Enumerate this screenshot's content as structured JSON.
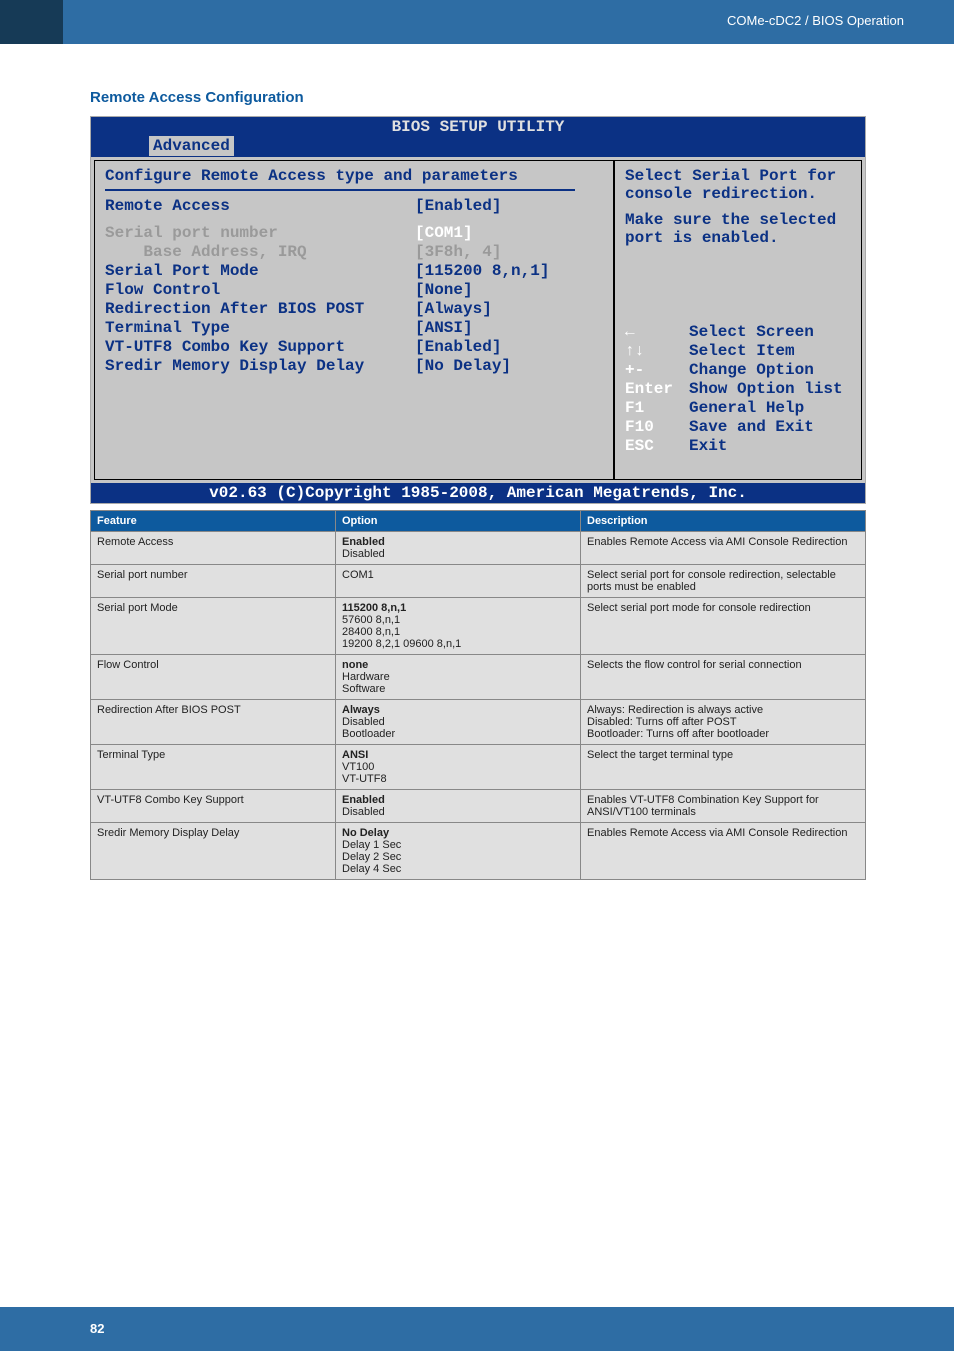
{
  "header": {
    "label": "COMe-cDC2 / BIOS Operation"
  },
  "title": "Remote Access Configuration",
  "bios": {
    "title": "BIOS SETUP UTILITY",
    "tab": "Advanced",
    "heading": "Configure Remote Access type and parameters",
    "rows": [
      {
        "label": "Remote Access",
        "value": "[Enabled]",
        "labelClass": "blue-txt",
        "valueClass": "blue-txt"
      },
      {
        "spacer": true
      },
      {
        "label": "Serial port number",
        "value": "[COM1]",
        "labelClass": "lgray-txt",
        "valueClass": "white-txt"
      },
      {
        "label": "    Base Address, IRQ",
        "value": "[3F8h, 4]",
        "labelClass": "lgray-txt",
        "valueClass": "lgray-txt"
      },
      {
        "label": "Serial Port Mode",
        "value": "[115200 8,n,1]",
        "labelClass": "blue-txt",
        "valueClass": "blue-txt"
      },
      {
        "label": "Flow Control",
        "value": "[None]",
        "labelClass": "blue-txt",
        "valueClass": "blue-txt"
      },
      {
        "label": "Redirection After BIOS POST",
        "value": "[Always]",
        "labelClass": "blue-txt",
        "valueClass": "blue-txt"
      },
      {
        "label": "Terminal Type",
        "value": "[ANSI]",
        "labelClass": "blue-txt",
        "valueClass": "blue-txt"
      },
      {
        "label": "VT-UTF8 Combo Key Support",
        "value": "[Enabled]",
        "labelClass": "blue-txt",
        "valueClass": "blue-txt"
      },
      {
        "label": "Sredir Memory Display Delay",
        "value": "[No Delay]",
        "labelClass": "blue-txt",
        "valueClass": "blue-txt"
      }
    ],
    "right": {
      "hint1": "Select Serial Port for",
      "hint2": "console redirection.",
      "hint3": "Make sure the selected",
      "hint4": "port is enabled."
    },
    "help": [
      {
        "key": "←",
        "label": "Select Screen"
      },
      {
        "key": "↑↓",
        "label": "Select Item"
      },
      {
        "key": "+-",
        "label": "Change Option"
      },
      {
        "key": "Enter",
        "label": "Show Option list"
      },
      {
        "key": "F1",
        "label": "General Help"
      },
      {
        "key": "F10",
        "label": "Save and Exit"
      },
      {
        "key": "ESC",
        "label": "Exit"
      }
    ],
    "footer": "v02.63 (C)Copyright 1985-2008, American Megatrends, Inc."
  },
  "tableHeaders": {
    "feature": "Feature",
    "option": "Option",
    "description": "Description"
  },
  "table": [
    {
      "feature": "Remote Access",
      "options": [
        {
          "t": "Enabled",
          "b": true
        },
        {
          "t": "Disabled"
        }
      ],
      "desc": "Enables Remote Access via AMI Console Redirection"
    },
    {
      "feature": "Serial port number",
      "options": [
        {
          "t": "COM1"
        }
      ],
      "desc": "Select serial port for console redirection, selectable ports must be enabled"
    },
    {
      "feature": "Serial port Mode",
      "options": [
        {
          "t": "115200 8,n,1",
          "b": true
        },
        {
          "t": "57600 8,n,1"
        },
        {
          "t": "28400 8,n,1"
        },
        {
          "t": "19200 8,2,1 09600 8,n,1"
        }
      ],
      "desc": "Select serial port mode for console redirection"
    },
    {
      "feature": "Flow Control",
      "options": [
        {
          "t": "none",
          "b": true
        },
        {
          "t": "Hardware"
        },
        {
          "t": "Software"
        }
      ],
      "desc": "Selects the flow control for serial connection"
    },
    {
      "feature": "Redirection After BIOS POST",
      "options": [
        {
          "t": "Always",
          "b": true
        },
        {
          "t": "Disabled"
        },
        {
          "t": "Bootloader"
        }
      ],
      "desc": "Always: Redirection is always active\nDisabled: Turns off after POST\nBootloader: Turns off after bootloader"
    },
    {
      "feature": "Terminal Type",
      "options": [
        {
          "t": "ANSI",
          "b": true
        },
        {
          "t": "VT100"
        },
        {
          "t": "VT-UTF8"
        }
      ],
      "desc": "Select the target terminal type"
    },
    {
      "feature": "VT-UTF8 Combo Key Support",
      "options": [
        {
          "t": "Enabled",
          "b": true
        },
        {
          "t": "Disabled"
        }
      ],
      "desc": "Enables VT-UTF8 Combination Key Support for ANSI/VT100 terminals"
    },
    {
      "feature": "Sredir Memory Display Delay",
      "options": [
        {
          "t": "No Delay",
          "b": true
        },
        {
          "t": "Delay 1 Sec"
        },
        {
          "t": "Delay 2 Sec"
        },
        {
          "t": "Delay 4 Sec"
        }
      ],
      "desc": "Enables Remote Access via AMI Console Redirection"
    }
  ],
  "pageNumber": "82"
}
